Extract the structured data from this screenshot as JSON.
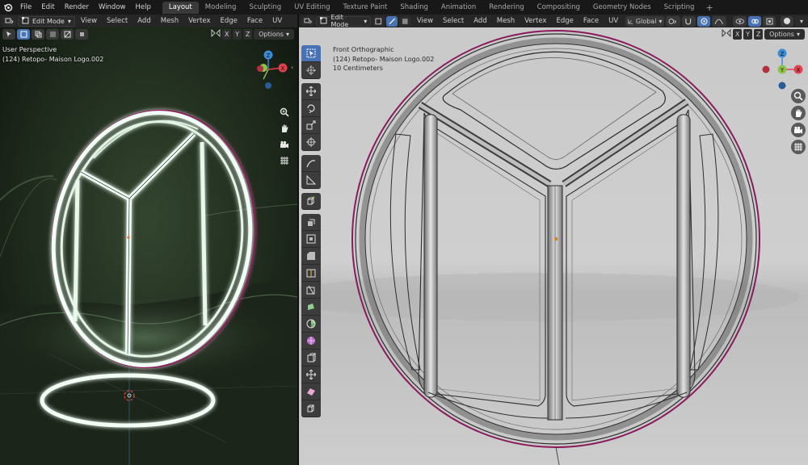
{
  "menu": [
    "File",
    "Edit",
    "Render",
    "Window",
    "Help"
  ],
  "workspaces": [
    "Layout",
    "Modeling",
    "Sculpting",
    "UV Editing",
    "Texture Paint",
    "Shading",
    "Animation",
    "Rendering",
    "Compositing",
    "Geometry Nodes",
    "Scripting"
  ],
  "active_workspace": "Layout",
  "left": {
    "mode": "Edit Mode",
    "menus": [
      "View",
      "Select",
      "Add",
      "Mesh",
      "Vertex",
      "Edge",
      "Face",
      "UV"
    ],
    "axes": [
      "X",
      "Y",
      "Z"
    ],
    "options_label": "Options",
    "view_name": "User Perspective",
    "object_name": "(124) Retopo- Maison Logo.002"
  },
  "right": {
    "mode": "Edit Mode",
    "menus": [
      "View",
      "Select",
      "Add",
      "Mesh",
      "Vertex",
      "Edge",
      "Face",
      "UV"
    ],
    "orientation": "Global",
    "axes": [
      "X",
      "Y",
      "Z"
    ],
    "options_label": "Options",
    "view_name": "Front Orthographic",
    "object_name": "(124) Retopo- Maison Logo.002",
    "scale": "10 Centimeters"
  },
  "gizmo": {
    "x": "X",
    "y": "Y",
    "z": "Z"
  },
  "colors": {
    "accent": "#4772b3",
    "x_axis": "#e0414f",
    "y_axis": "#8bc34a",
    "z_axis": "#3a8cd8",
    "glow": "#dff7e9",
    "edge_magenta": "#8a1a5c"
  },
  "tools": [
    "select-box",
    "cursor",
    "move",
    "rotate",
    "scale",
    "transform",
    "annotate",
    "measure",
    "add-cube",
    "extrude",
    "inset",
    "bevel",
    "loop-cut",
    "knife",
    "poly-build",
    "spin",
    "smooth",
    "edge-slide",
    "shrink-fatten",
    "shear",
    "rip"
  ]
}
